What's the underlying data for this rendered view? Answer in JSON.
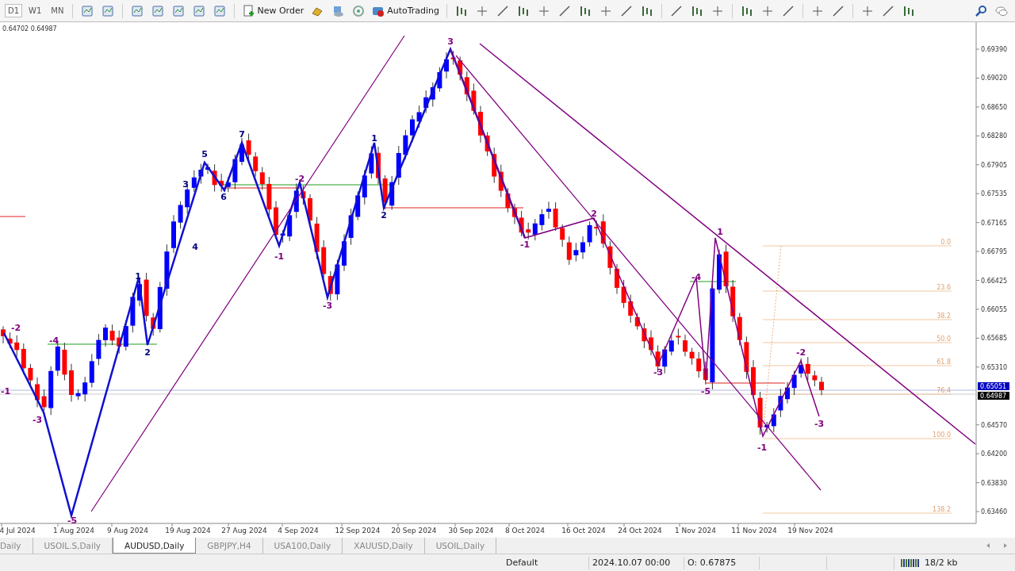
{
  "toolbar": {
    "periods": [
      {
        "label": "D1",
        "selected": true
      },
      {
        "label": "W1",
        "selected": false
      },
      {
        "label": "MN",
        "selected": false
      }
    ],
    "new_order": "New Order",
    "autotrading": "AutoTrading"
  },
  "chart": {
    "bid_ask": "0.64702 0.64987",
    "price_ticks": [
      "0.69390",
      "0.69020",
      "0.68650",
      "0.68280",
      "0.67905",
      "0.67535",
      "0.67165",
      "0.66795",
      "0.66425",
      "0.66055",
      "0.65685",
      "0.65310",
      "0.64570",
      "0.64200",
      "0.63830",
      "0.63460"
    ],
    "price_tags": [
      {
        "text": "0.65051",
        "color": "#0000c0"
      },
      {
        "text": "0.64987",
        "color": "#000000"
      }
    ],
    "dates": [
      "4 Jul 2024",
      "1 Aug 2024",
      "9 Aug 2024",
      "19 Aug 2024",
      "27 Aug 2024",
      "4 Sep 2024",
      "12 Sep 2024",
      "20 Sep 2024",
      "30 Sep 2024",
      "8 Oct 2024",
      "16 Oct 2024",
      "24 Oct 2024",
      "1 Nov 2024",
      "11 Nov 2024",
      "19 Nov 2024"
    ],
    "wave_labels": [
      {
        "text": "-2",
        "color": "#800080"
      },
      {
        "text": "-1",
        "color": "#800080"
      },
      {
        "text": "-4",
        "color": "#800080"
      },
      {
        "text": "-3",
        "color": "#800080"
      },
      {
        "text": "-5",
        "color": "#800080"
      },
      {
        "text": "1",
        "color": "#000080"
      },
      {
        "text": "2",
        "color": "#000080"
      },
      {
        "text": "3",
        "color": "#000080"
      },
      {
        "text": "4",
        "color": "#000080"
      },
      {
        "text": "5",
        "color": "#000080"
      },
      {
        "text": "6",
        "color": "#000080"
      },
      {
        "text": "7",
        "color": "#000080"
      },
      {
        "text": "-2",
        "color": "#800080"
      },
      {
        "text": "-1",
        "color": "#800080"
      },
      {
        "text": "-3",
        "color": "#800080"
      },
      {
        "text": "1",
        "color": "#000080"
      },
      {
        "text": "2",
        "color": "#000080"
      },
      {
        "text": "3",
        "color": "#800080"
      },
      {
        "text": "-1",
        "color": "#800080"
      },
      {
        "text": "2",
        "color": "#800080"
      },
      {
        "text": "-3",
        "color": "#800080"
      },
      {
        "text": "-4",
        "color": "#800080"
      },
      {
        "text": "1",
        "color": "#800080"
      },
      {
        "text": "-5",
        "color": "#800080"
      },
      {
        "text": "-2",
        "color": "#800080"
      },
      {
        "text": "-1",
        "color": "#800080"
      },
      {
        "text": "-3",
        "color": "#800080"
      }
    ],
    "fib_levels": [
      "0.0",
      "23.6",
      "38.2",
      "50.0",
      "61.8",
      "76.4",
      "100.0",
      "138.2"
    ]
  },
  "tabs": [
    {
      "label": "Daily",
      "selected": false
    },
    {
      "label": "USOIL.S,Daily",
      "selected": false
    },
    {
      "label": "AUDUSD,Daily",
      "selected": true
    },
    {
      "label": "GBPJPY,H4",
      "selected": false
    },
    {
      "label": "USA100,Daily",
      "selected": false
    },
    {
      "label": "XAUUSD,Daily",
      "selected": false
    },
    {
      "label": "USOIL,Daily",
      "selected": false
    }
  ],
  "status_bar": {
    "profile": "Default",
    "time": "2024.10.07 00:00",
    "open": "O: 0.67875",
    "traffic": "18/2 kb"
  }
}
